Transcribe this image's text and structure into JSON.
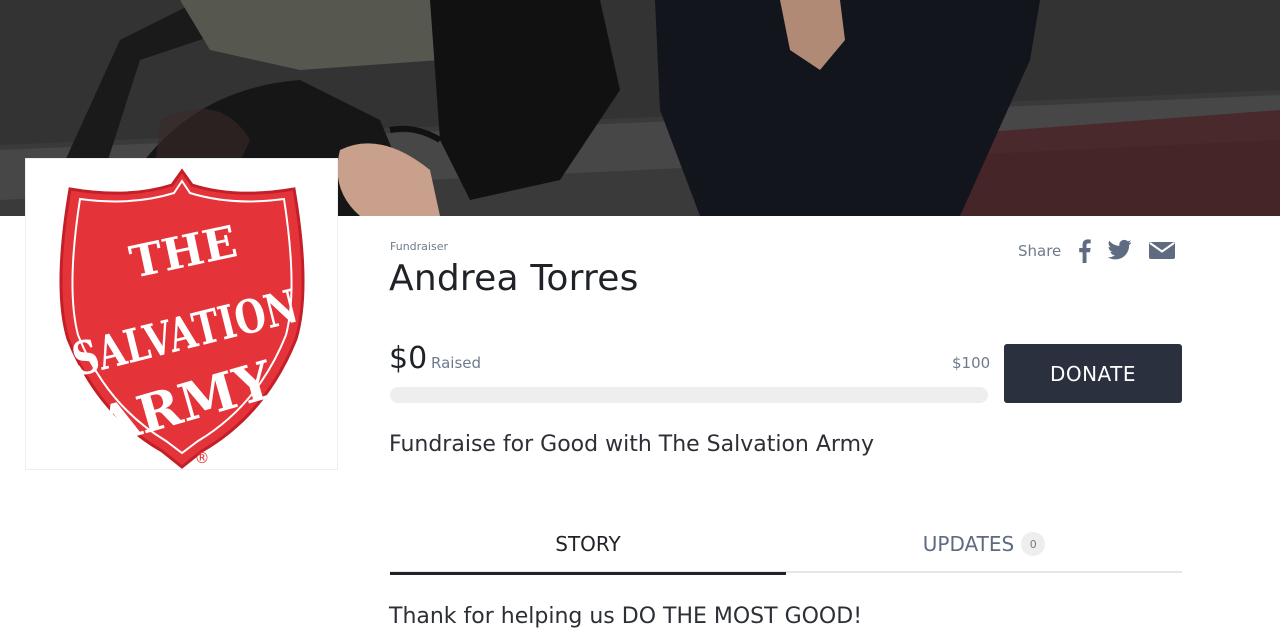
{
  "hero": {
    "image": "campaign-cover-photo"
  },
  "logo": {
    "text_line1": "THE",
    "text_line2": "SALVATION",
    "text_line3": "ARMY",
    "mark": "®",
    "shield_color": "#e5333a"
  },
  "fundraiser": {
    "label": "Fundraiser",
    "name": "Andrea Torres"
  },
  "share": {
    "label": "Share",
    "icons": [
      "facebook-icon",
      "twitter-icon",
      "email-icon"
    ]
  },
  "progress": {
    "raised": "$0",
    "raised_label": "Raised",
    "goal": "$100",
    "fraction": 0
  },
  "donate": {
    "label": "DONATE",
    "color": "#2b303f"
  },
  "tagline": "Fundraise for Good with The Salvation Army",
  "tabs": [
    {
      "label": "STORY",
      "active": true
    },
    {
      "label": "UPDATES",
      "count": "0"
    }
  ],
  "story": {
    "preview": "Thank for helping us DO THE MOST GOOD!"
  }
}
